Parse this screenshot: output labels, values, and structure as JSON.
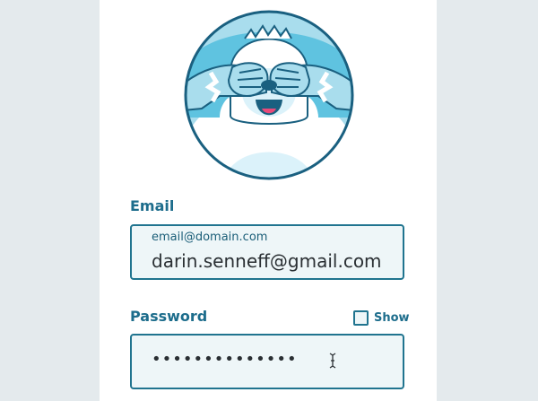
{
  "email": {
    "label": "Email",
    "placeholder": "email@domain.com",
    "value": "darin.senneff@gmail.com"
  },
  "password": {
    "label": "Password",
    "value": "••••••••••••••",
    "show_label": "Show",
    "show_checked": false
  },
  "colors": {
    "page_bg": "#e4eaed",
    "accent": "#1d6d8c",
    "field_bg": "#eef6f8",
    "yeti_blue": "#5fc3e0",
    "yeti_fur": "#dbf2fa"
  },
  "avatar": {
    "icon": "yeti-covering-eyes-avatar"
  }
}
